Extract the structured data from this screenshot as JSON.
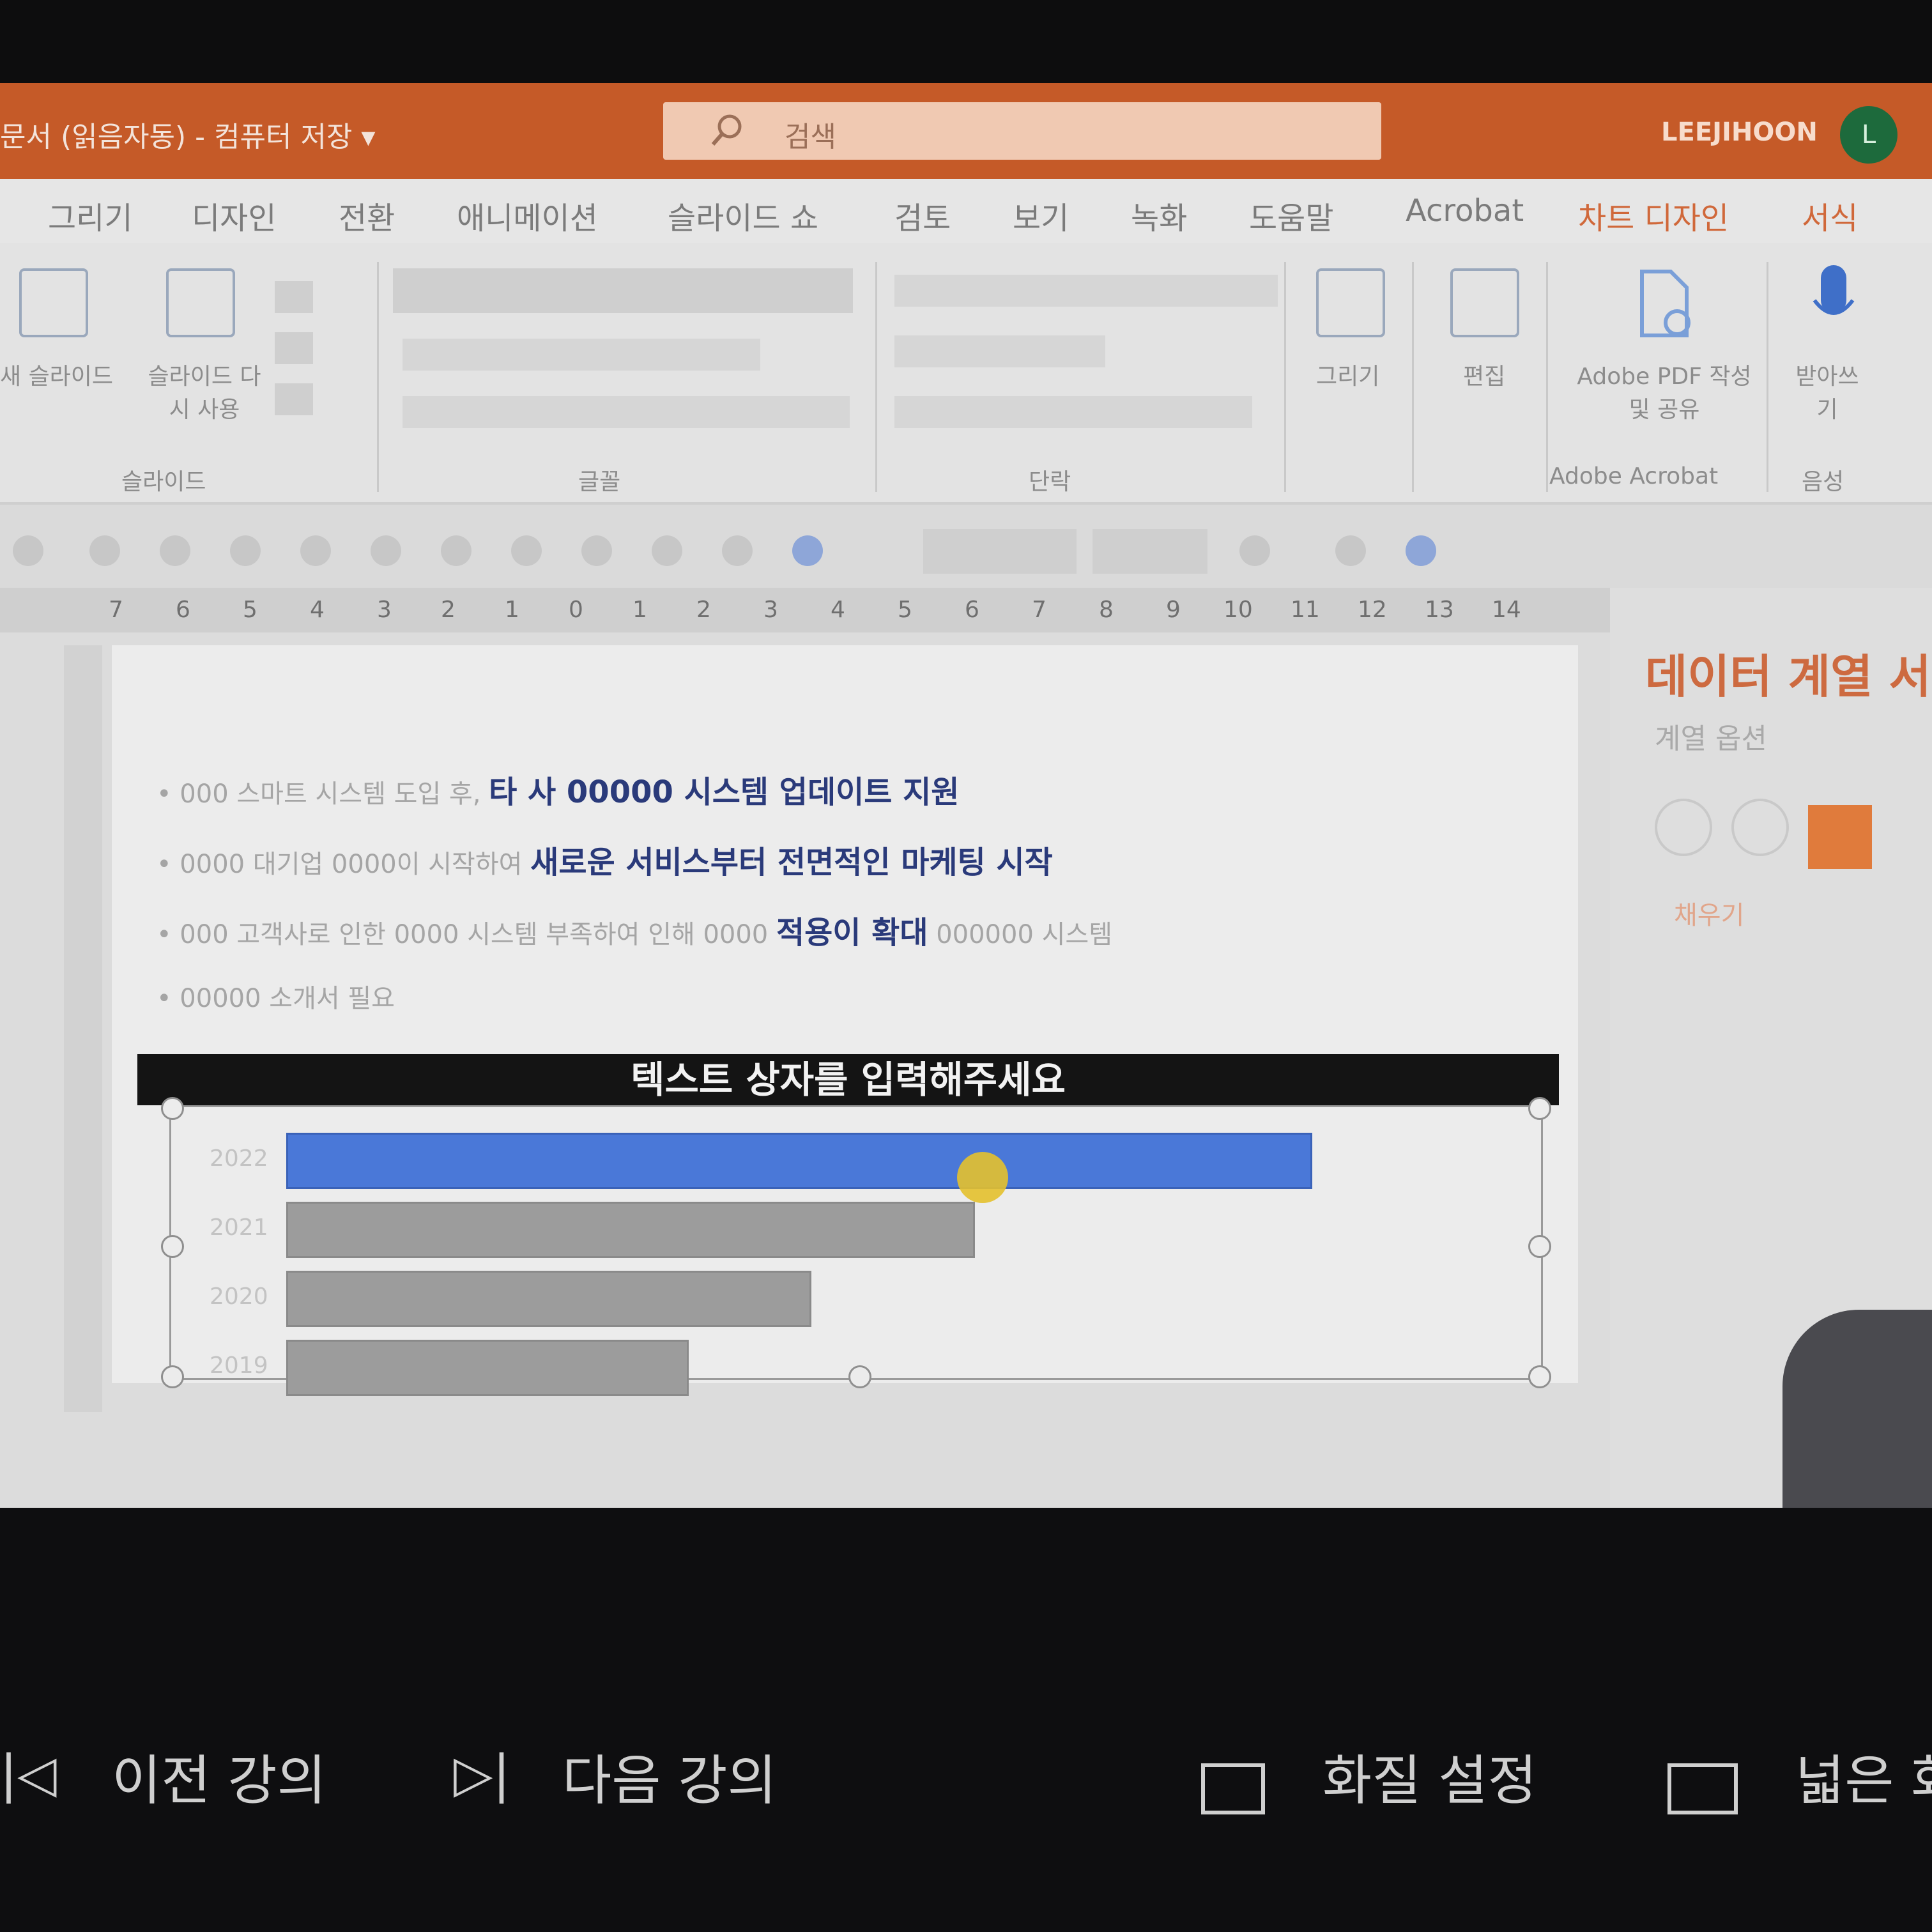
{
  "window": {
    "doc_title": "문서 (읽음자동) - 컴퓨터 저장 ▾",
    "search_placeholder": "검색",
    "user_name": "LEEJIHOON",
    "avatar_initial": "L"
  },
  "tabs": [
    "그리기",
    "디자인",
    "전환",
    "애니메이션",
    "슬라이드 쇼",
    "검토",
    "보기",
    "녹화",
    "도움말",
    "Acrobat",
    "차트 디자인",
    "서식"
  ],
  "ribbon": {
    "slide_new": "새 슬라이드",
    "slide_reset": "슬라이드 다시 사용",
    "group_slides": "슬라이드",
    "group_font": "글꼴",
    "group_paragraph": "단락",
    "draw": "그리기",
    "edit": "편집",
    "adobe_pdf": "Adobe PDF 작성 및 공유",
    "group_acrobat": "Adobe Acrobat",
    "dictate": "받아쓰기",
    "group_voice": "음성"
  },
  "ruler": [
    "7",
    "6",
    "5",
    "4",
    "3",
    "2",
    "1",
    "0",
    "1",
    "2",
    "3",
    "4",
    "5",
    "6",
    "7",
    "8",
    "9",
    "10",
    "11",
    "12",
    "13",
    "14"
  ],
  "slide": {
    "bullets": [
      {
        "pre": "• 000 스마트 시스템 도입 후, ",
        "bold": "타 사 00000 시스템 업데이트 지원",
        "post": ""
      },
      {
        "pre": "• 0000 대기업 0000이 시작하여 ",
        "bold": "새로운 서비스부터 전면적인 마케팅 시작",
        "post": ""
      },
      {
        "pre": "• 000 고객사로 인한 0000 시스템 부족하여 인해 0000 ",
        "bold": "적용이 확대",
        "post": " 000000 시스템"
      },
      {
        "pre": "• 00000 소개서 필요",
        "bold": "",
        "post": ""
      }
    ],
    "banner": "텍스트 상자를 입력해주세요"
  },
  "chart_data": {
    "type": "bar",
    "orientation": "horizontal",
    "categories": [
      "2022",
      "2021",
      "2020",
      "2019"
    ],
    "values": [
      100,
      67,
      51,
      39
    ],
    "highlight_color": "#4a78d8",
    "bar_color": "#9c9c9c"
  },
  "pane": {
    "title": "데이터 계열 서식",
    "option": "계열 옵션",
    "fill": "채우기"
  },
  "player": {
    "prev": "이전 강의",
    "next": "다음 강의",
    "quality": "화질 설정",
    "wide": "넓은 화면"
  }
}
